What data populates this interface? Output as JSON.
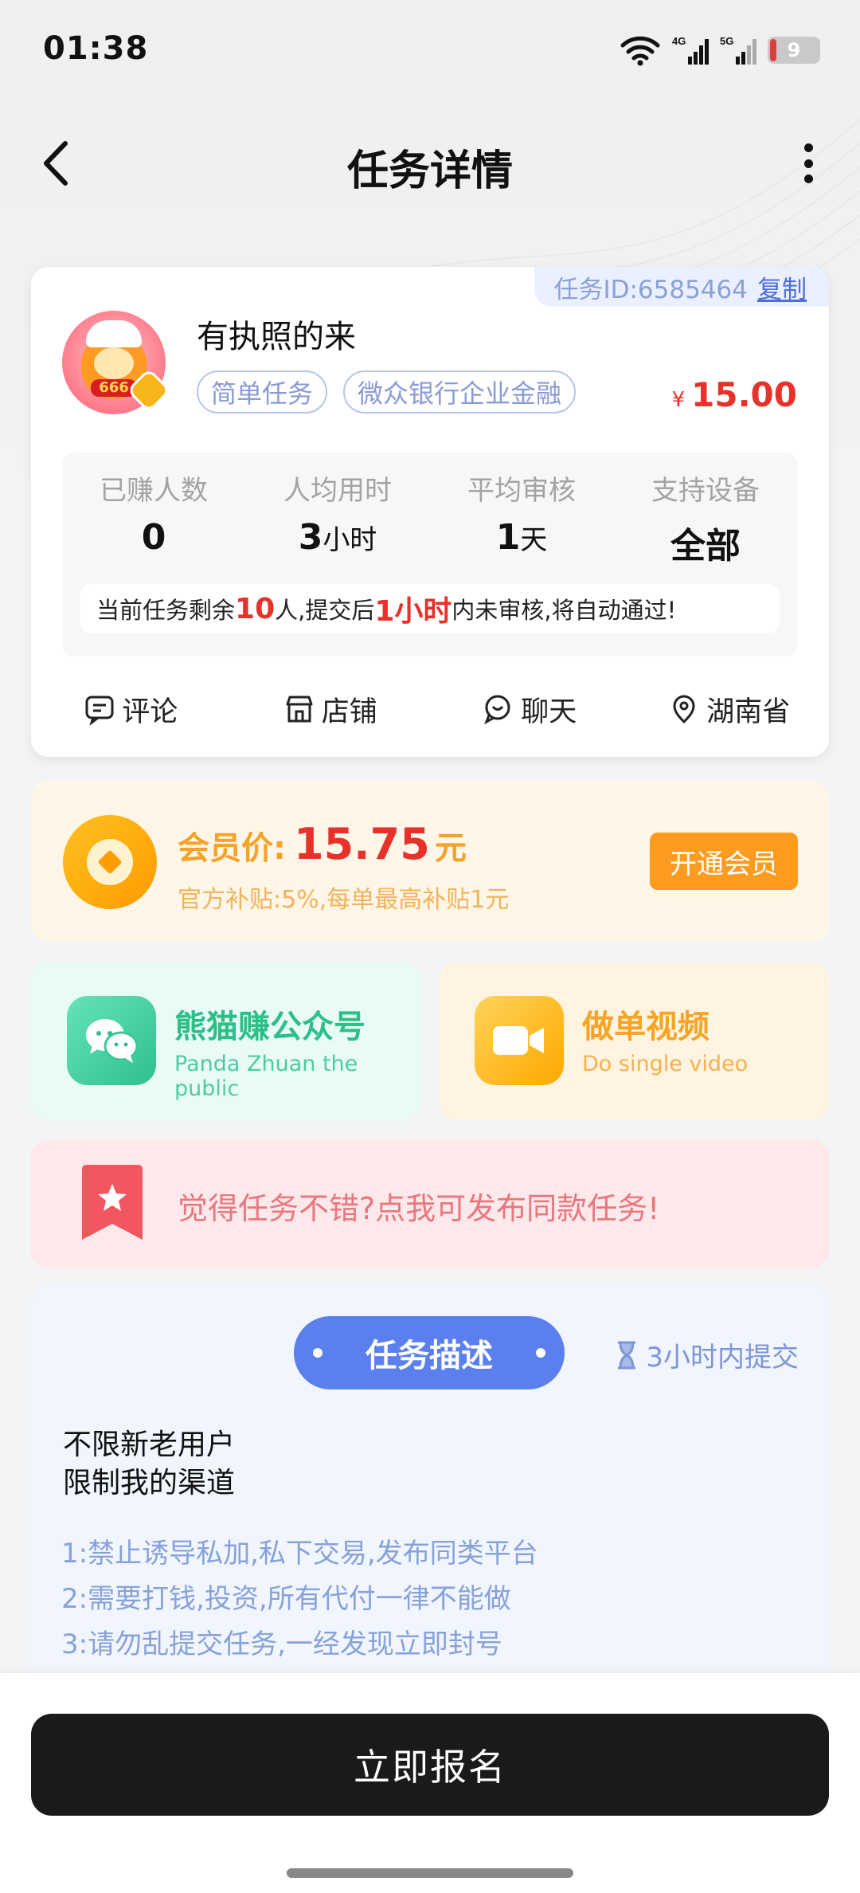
{
  "status_bar": {
    "time": "01:38",
    "battery": "9"
  },
  "nav": {
    "title": "任务详情"
  },
  "task": {
    "id_label": "任务ID:6585464",
    "copy_label": "复制",
    "name": "有执照的来",
    "tags": [
      "简单任务",
      "微众银行企业金融"
    ],
    "price_symbol": "¥",
    "price": "15.00",
    "stats": [
      {
        "label": "已赚人数",
        "value": "0",
        "unit": ""
      },
      {
        "label": "人均用时",
        "value": "3",
        "unit": "小时"
      },
      {
        "label": "平均审核",
        "value": "1",
        "unit": "天"
      },
      {
        "label": "支持设备",
        "value": "全部",
        "unit": ""
      }
    ],
    "notice": {
      "part1": "当前任务剩余",
      "count": "10",
      "part2": "人,提交后",
      "time": "1小时",
      "part3": "内未审核,将自动通过!"
    },
    "actions": [
      "评论",
      "店铺",
      "聊天",
      "湖南省"
    ]
  },
  "member": {
    "label": "会员价:",
    "price": "15.75",
    "unit": "元",
    "subtitle": "官方补贴:5%,每单最高补贴1元",
    "button": "开通会员"
  },
  "tiles": {
    "wechat": {
      "title": "熊猫赚公众号",
      "subtitle": "Panda Zhuan the public"
    },
    "video": {
      "title": "做单视频",
      "subtitle": "Do single video"
    }
  },
  "publish": {
    "text": "觉得任务不错?点我可发布同款任务!"
  },
  "description": {
    "title": "任务描述",
    "deadline": "3小时内提交",
    "lines": [
      "不限新老用户",
      "限制我的渠道"
    ],
    "rules": [
      "1:禁止诱导私加,私下交易,发布同类平台",
      "2:需要打钱,投资,所有代付一律不能做",
      "3:请勿乱提交任务,一经发现立即封号"
    ]
  },
  "bottom": {
    "button": "立即报名"
  },
  "colors": {
    "accent_red": "#e6322a",
    "accent_blue": "#5b80ee",
    "orange": "#ff9b1e",
    "dark_button": "#1a1a1a"
  }
}
